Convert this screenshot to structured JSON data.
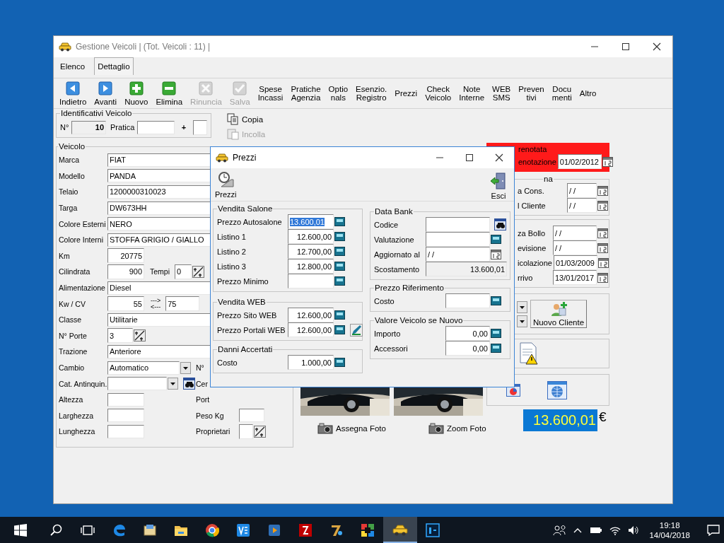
{
  "main_window": {
    "title": "Gestione Veicoli | (Tot. Veicoli : 11) |",
    "tabs": [
      {
        "label": "Elenco",
        "selected": false
      },
      {
        "label": "Dettaglio",
        "selected": true
      }
    ],
    "toolbar": [
      {
        "kind": "back",
        "label": "Indietro",
        "disabled": false
      },
      {
        "kind": "forward",
        "label": "Avanti",
        "disabled": false
      },
      {
        "kind": "add",
        "label": "Nuovo",
        "disabled": false
      },
      {
        "kind": "remove",
        "label": "Elimina",
        "disabled": false
      },
      {
        "kind": "cancel",
        "label": "Rinuncia",
        "disabled": true
      },
      {
        "kind": "confirm",
        "label": "Salva",
        "disabled": true
      },
      {
        "kind": "text",
        "label": "Spese\nIncassi",
        "disabled": false
      },
      {
        "kind": "text",
        "label": "Pratiche\nAgenzia",
        "disabled": false
      },
      {
        "kind": "text",
        "label": "Optio\nnals",
        "disabled": false
      },
      {
        "kind": "text",
        "label": "Esenzio.\nRegistro",
        "disabled": false
      },
      {
        "kind": "text",
        "label": "Prezzi",
        "disabled": false
      },
      {
        "kind": "text",
        "label": "Check\nVeicolo",
        "disabled": false
      },
      {
        "kind": "text",
        "label": "Note\nInterne",
        "disabled": false
      },
      {
        "kind": "text",
        "label": "WEB\nSMS",
        "disabled": false
      },
      {
        "kind": "text",
        "label": "Preven\ntivi",
        "disabled": false
      },
      {
        "kind": "text",
        "label": "Docu\nmenti",
        "disabled": false
      },
      {
        "kind": "text",
        "label": "Altro",
        "disabled": false
      }
    ],
    "identifiers": {
      "title": "Identificativi Veicolo",
      "number_label": "N°",
      "number": "10",
      "file_label": "Pratica",
      "plus": "+"
    },
    "clipboard": [
      {
        "kind": "copy",
        "label": "Copia",
        "disabled": false
      },
      {
        "kind": "paste",
        "label": "Incolla",
        "disabled": true
      }
    ],
    "vehicle": {
      "title": "Veicolo",
      "rows": [
        {
          "kind": "wide",
          "label": "Marca",
          "value": "FIAT"
        },
        {
          "kind": "wide",
          "label": "Modello",
          "value": "PANDA"
        },
        {
          "kind": "wide",
          "label": "Telaio",
          "value": "1200000310023"
        },
        {
          "kind": "wide",
          "label": "Targa",
          "value": "DW673HH"
        },
        {
          "kind": "wide",
          "label": "Colore Esterni",
          "value": "NERO"
        },
        {
          "kind": "wide",
          "label": "Colore Interni",
          "value": "STOFFA GRIGIO / GIALLO"
        },
        {
          "kind": "short",
          "label": "Km",
          "value": "20775"
        },
        {
          "kind": "pair",
          "label": "Cilindrata",
          "value": "900",
          "extra_label": "Tempi",
          "extra_value": "0"
        },
        {
          "kind": "wide",
          "label": "Alimentazione",
          "value": "Diesel"
        },
        {
          "kind": "convert",
          "label": "Kw / CV",
          "value": "55",
          "arrow_right": "--->",
          "arrow_left": "<---",
          "extra_value": "75"
        },
        {
          "kind": "wide",
          "label": "Classe",
          "value": "Utilitarie"
        },
        {
          "kind": "spin",
          "label": "N° Porte",
          "value": "3"
        },
        {
          "kind": "wide",
          "label": "Trazione",
          "value": "Anteriore"
        },
        {
          "kind": "combo",
          "label": "Cambio",
          "value": "Automatico",
          "side_label": "N°"
        },
        {
          "kind": "combo_search",
          "label": "Cat. Antinquin.",
          "side_label": "Cer"
        },
        {
          "kind": "blank",
          "label": "Altezza",
          "side_label": "Port"
        },
        {
          "kind": "blank_with_field",
          "label": "Larghezza",
          "side_label": "Peso Kg"
        },
        {
          "kind": "blank_with_spin",
          "label": "Lunghezza",
          "side_label": "Proprietari"
        }
      ]
    },
    "photo_buttons": [
      {
        "label": "Assegna Foto"
      },
      {
        "label": "Zoom Foto"
      }
    ],
    "reservation": {
      "label": "renotata",
      "date_label": "enotazione",
      "date": "01/02/2012"
    },
    "delivery": {
      "title": "na",
      "rows": [
        {
          "label": "a Cons.",
          "value": "/ /"
        },
        {
          "label": "l Cliente",
          "value": "/ /"
        }
      ]
    },
    "deadlines": {
      "rows": [
        {
          "label": "za Bollo",
          "value": "/ /"
        },
        {
          "label": "evisione",
          "value": "/ /"
        },
        {
          "label": "icolazione",
          "value": "01/03/2009"
        },
        {
          "label": "rrivo",
          "value": "13/01/2017"
        }
      ]
    },
    "new_customer": {
      "label": "Nuovo Cliente"
    },
    "total": {
      "value": "13.600,01",
      "currency": "€"
    }
  },
  "prices_dialog": {
    "title": "Prezzi",
    "tools": [
      {
        "kind": "prices",
        "label": "Prezzi"
      },
      {
        "kind": "exit",
        "label": "Esci"
      }
    ],
    "left_groups": [
      {
        "kind": "sale",
        "title": "Vendita Salone",
        "rows": [
          {
            "kind": "calc",
            "label": "Prezzo Autosalone",
            "value": "13.600,01",
            "highlighted": true
          },
          {
            "kind": "calc",
            "label": "Listino 1",
            "value": "12.600,00",
            "highlighted": false
          },
          {
            "kind": "calc",
            "label": "Listino 2",
            "value": "12.700,00",
            "highlighted": false
          },
          {
            "kind": "calc",
            "label": "Listino 3",
            "value": "12.800,00",
            "highlighted": false
          },
          {
            "kind": "calc",
            "label": "Prezzo Minimo"
          }
        ]
      },
      {
        "kind": "sale",
        "title": "Vendita WEB",
        "rows": [
          {
            "kind": "calc",
            "label": "Prezzo Sito WEB",
            "value": "12.600,00",
            "highlighted": false
          },
          {
            "kind": "calc_edit",
            "label": "Prezzo Portali WEB",
            "value": "12.600,00",
            "highlighted": false
          }
        ]
      },
      {
        "kind": "sale",
        "title": "Danni Accertati",
        "rows": [
          {
            "kind": "calc",
            "label": "Costo",
            "value": "1.000,00",
            "highlighted": false
          }
        ]
      }
    ],
    "right_groups": [
      {
        "kind": "bank",
        "title": "Data Bank",
        "rows": [
          {
            "kind": "search",
            "label": "Codice"
          },
          {
            "kind": "calc",
            "label": "Valutazione"
          },
          {
            "kind": "date",
            "label": "Aggiornato al",
            "value": "/ /",
            "highlighted": false
          },
          {
            "kind": "readonly",
            "label": "Scostamento",
            "value": "13.600,01",
            "highlighted": false
          }
        ]
      },
      {
        "kind": "value",
        "title": "Prezzo Riferimento",
        "rows": [
          {
            "kind": "calc",
            "label": "Costo"
          }
        ]
      },
      {
        "kind": "value",
        "title": "Valore Veicolo se Nuovo",
        "rows": [
          {
            "kind": "calc",
            "label": "Importo",
            "value": "0,00",
            "highlighted": false
          },
          {
            "kind": "calc",
            "label": "Accessori",
            "value": "0,00",
            "highlighted": false
          }
        ]
      }
    ]
  },
  "taskbar": {
    "apps": [
      {
        "kind": "edge",
        "selected": false
      },
      {
        "kind": "mail",
        "selected": false
      },
      {
        "kind": "folder",
        "selected": false
      },
      {
        "kind": "chrome",
        "selected": false
      },
      {
        "kind": "ve",
        "selected": false
      },
      {
        "kind": "player",
        "selected": false
      },
      {
        "kind": "filezilla",
        "selected": false
      },
      {
        "kind": "seven",
        "selected": false
      },
      {
        "kind": "tiles",
        "selected": false
      },
      {
        "kind": "car",
        "selected": true
      },
      {
        "kind": "ps",
        "selected": false
      }
    ],
    "clock": {
      "time": "19:18",
      "date": "14/04/2018"
    }
  }
}
